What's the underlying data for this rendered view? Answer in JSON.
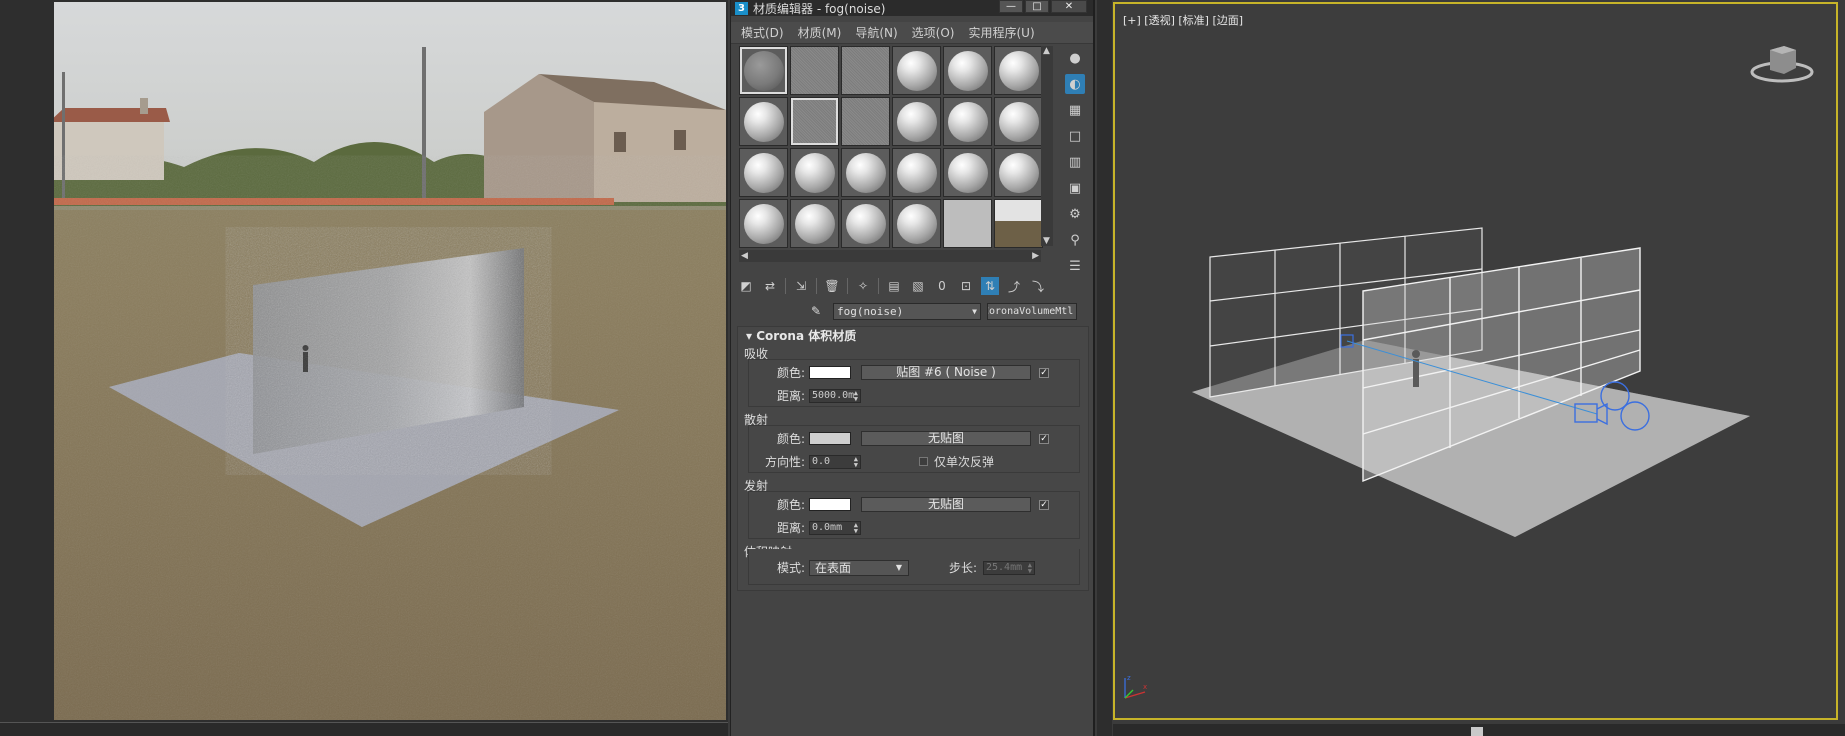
{
  "material_editor": {
    "title": "材质编辑器 - fog(noise)",
    "app_icon": "3",
    "window_controls": [
      "—",
      "□",
      "✕"
    ],
    "menu": [
      "模式(D)",
      "材质(M)",
      "导航(N)",
      "选项(O)",
      "实用程序(U)"
    ],
    "material_name": "fog(noise)",
    "material_type": "CoronaVolumeMtl",
    "rollout_title": "Corona 体积材质",
    "absorption": {
      "group": "吸收",
      "color_label": "颜色:",
      "color": "#ffffff",
      "map_button": "贴图 #6  ( Noise )",
      "map_enabled": true,
      "distance_label": "距离:",
      "distance": "5000.0m"
    },
    "scattering": {
      "group": "散射",
      "color_label": "颜色:",
      "color": "#cfcfcf",
      "map_button": "无贴图",
      "map_enabled": true,
      "directionality_label": "方向性:",
      "directionality": "0.0",
      "single_bounce_label": "仅单次反弹"
    },
    "emission": {
      "group": "发射",
      "color_label": "颜色:",
      "color": "#ffffff",
      "map_button": "无贴图",
      "map_enabled": true,
      "distance_label": "距离:",
      "distance": "0.0mm"
    },
    "volume_mapping": {
      "group": "体积映射",
      "mode_label": "模式:",
      "mode": "在表面",
      "step_label": "步长:",
      "step": "25.4mm"
    }
  },
  "viewport": {
    "label": "[+] [透视] [标准] [边面]",
    "active_border_color": "#c7b429",
    "axis_x": "x",
    "axis_z": "z"
  }
}
